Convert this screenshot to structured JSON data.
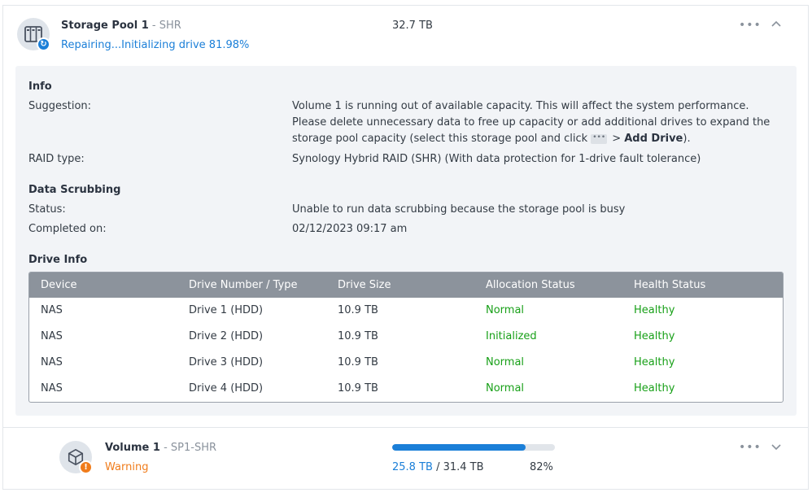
{
  "storage_pool": {
    "name": "Storage Pool 1",
    "separator": " - ",
    "type": "SHR",
    "status": "Repairing...Initializing drive 81.98%",
    "capacity": "32.7 TB",
    "icon": "storage-pool-icon",
    "status_badge_icon": "sync-icon"
  },
  "info": {
    "section_title": "Info",
    "suggestion_label": "Suggestion:",
    "suggestion_text_1": "Volume 1 is running out of available capacity. This will affect the system performance. Please delete unnecessary data to free up capacity or add additional drives to expand the storage pool capacity (select this storage pool and click",
    "suggestion_more_glyph": "•••",
    "suggestion_arrow": "> ",
    "suggestion_action": "Add Drive",
    "suggestion_end": ").",
    "raid_label": "RAID type:",
    "raid_value": "Synology Hybrid RAID (SHR) (With data protection for 1-drive fault tolerance)"
  },
  "scrubbing": {
    "section_title": "Data Scrubbing",
    "status_label": "Status:",
    "status_value": "Unable to run data scrubbing because the storage pool is busy",
    "completed_label": "Completed on:",
    "completed_value": "02/12/2023 09:17 am"
  },
  "drive_info": {
    "section_title": "Drive Info",
    "columns": [
      "Device",
      "Drive Number / Type",
      "Drive Size",
      "Allocation Status",
      "Health Status"
    ],
    "rows": [
      {
        "device": "NAS",
        "drive": "Drive 1 (HDD)",
        "size": "10.9 TB",
        "allocation": "Normal",
        "health": "Healthy"
      },
      {
        "device": "NAS",
        "drive": "Drive 2 (HDD)",
        "size": "10.9 TB",
        "allocation": "Initialized",
        "health": "Healthy"
      },
      {
        "device": "NAS",
        "drive": "Drive 3 (HDD)",
        "size": "10.9 TB",
        "allocation": "Normal",
        "health": "Healthy"
      },
      {
        "device": "NAS",
        "drive": "Drive 4 (HDD)",
        "size": "10.9 TB",
        "allocation": "Normal",
        "health": "Healthy"
      }
    ]
  },
  "volume": {
    "name": "Volume 1",
    "separator": " - ",
    "type": "SP1-SHR",
    "status": "Warning",
    "used": "25.8 TB",
    "usage_separator": " / ",
    "total": "31.4 TB",
    "percent": "82%",
    "usage_fraction": 0.82,
    "icon": "volume-cube-icon",
    "status_badge_icon": "warning-icon"
  },
  "colors": {
    "accent": "#1b7fd8",
    "healthy": "#18a018",
    "warning": "#f07c1b"
  }
}
